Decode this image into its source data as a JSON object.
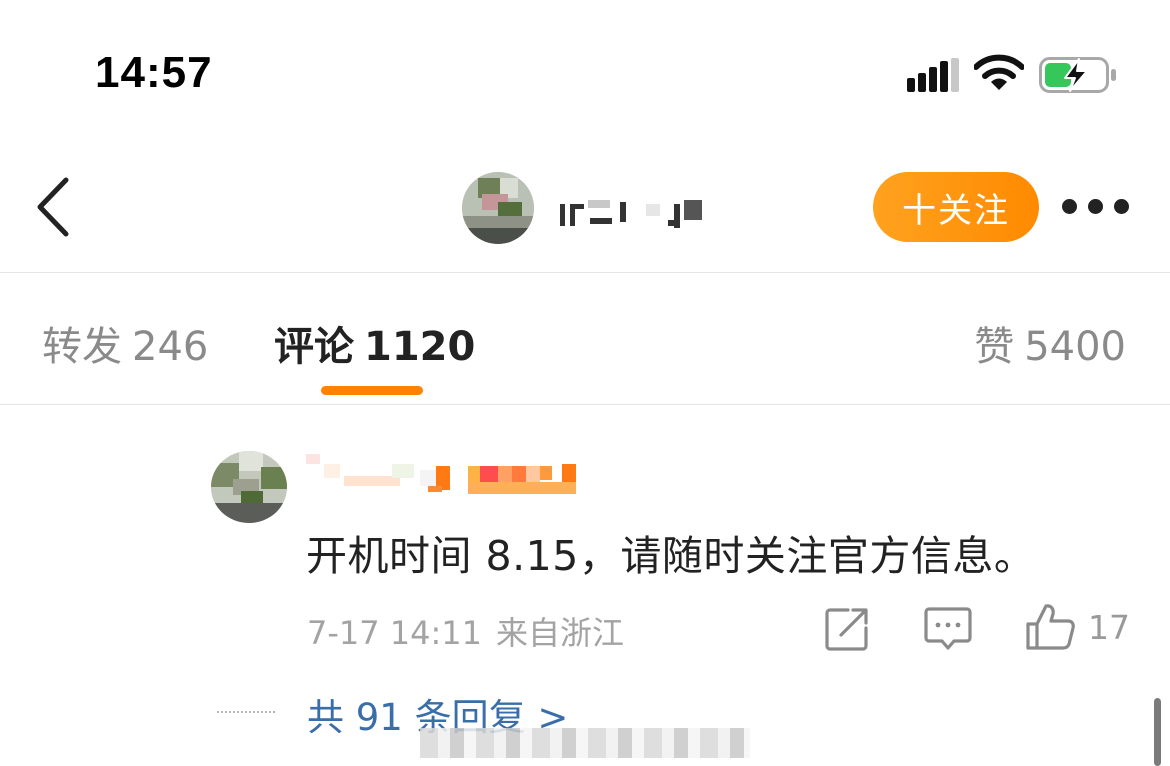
{
  "status_bar": {
    "time": "14:57"
  },
  "header": {
    "follow_label": "十关注"
  },
  "tabs": [
    {
      "label": "转发",
      "count": "246"
    },
    {
      "label": "评论",
      "count": "1120"
    },
    {
      "label": "赞",
      "count": "5400"
    }
  ],
  "comment": {
    "text": "开机时间 8.15，请随时关注官方信息。",
    "date": "7-17 14:11",
    "location": "来自浙江",
    "like_count": "17",
    "replies_label": "共 91 条回复 >"
  },
  "colors": {
    "accent": "#ff8200",
    "link": "#3a6ea8"
  },
  "icons": [
    "signal-icon",
    "wifi-icon",
    "battery-charging-icon",
    "back-icon",
    "more-icon",
    "share-icon",
    "comment-icon",
    "like-icon"
  ]
}
